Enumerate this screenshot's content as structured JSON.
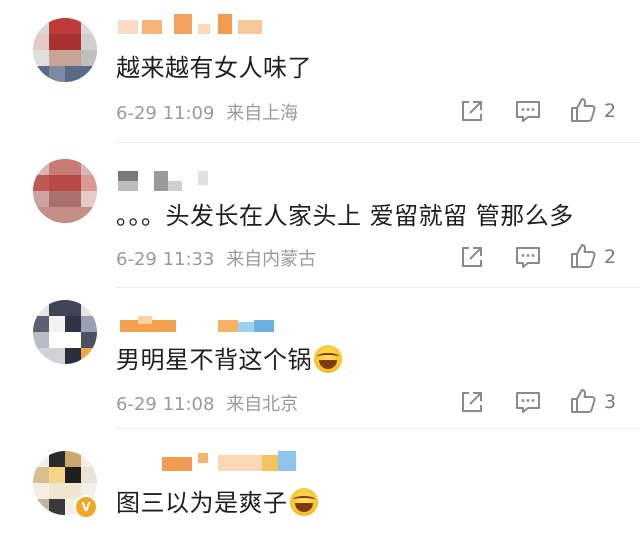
{
  "comments": [
    {
      "text": "越来越有女人味了",
      "time": "6-29 11:09",
      "location": "来自上海",
      "likes": "2",
      "avatar_icon": "pixelated-avatar-icon",
      "verified": false
    },
    {
      "text": "。。。头发长在人家头上 爱留就留 管那么多",
      "time": "6-29 11:33",
      "location": "来自内蒙古",
      "likes": "2",
      "avatar_icon": "pixelated-avatar-icon",
      "verified": false
    },
    {
      "text": "男明星不背这个锅",
      "emoji": "laughing-crying-emoji-icon",
      "time": "6-29 11:08",
      "location": "来自北京",
      "likes": "3",
      "avatar_icon": "pixelated-avatar-icon",
      "verified": false
    },
    {
      "text": "图三以为是爽子",
      "emoji": "laughing-crying-emoji-icon",
      "time": "",
      "location": "",
      "likes": "",
      "avatar_icon": "pixelated-avatar-icon",
      "verified": true
    }
  ],
  "icons": {
    "share": "share-icon",
    "reply": "comment-icon",
    "like": "thumbs-up-icon",
    "verified": "verified-badge-icon"
  },
  "colors": {
    "text": "#1f1f1f",
    "meta": "#9a9a9a",
    "icon": "#8a8a8a",
    "verified": "#f5a623"
  }
}
